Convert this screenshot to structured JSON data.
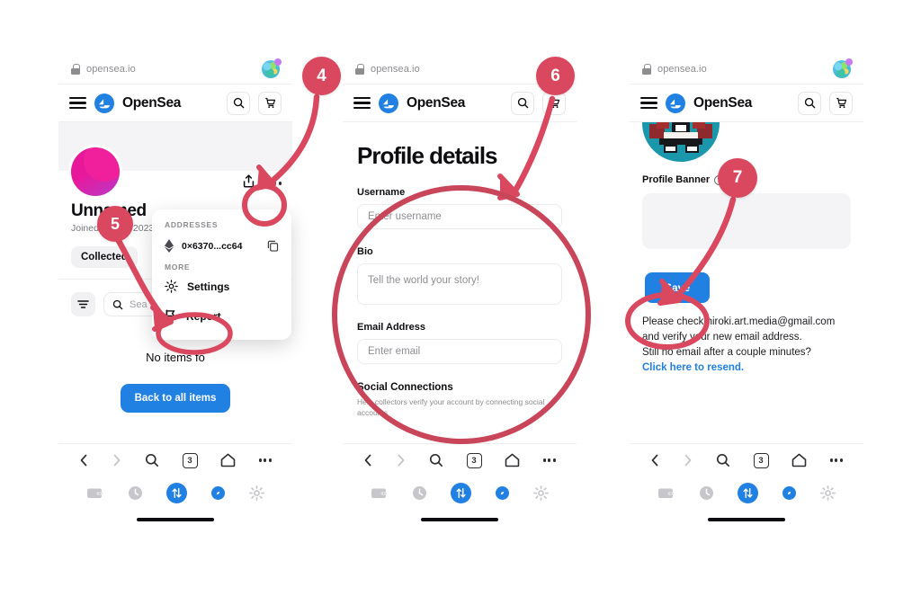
{
  "meta": {
    "accent_blue": "#2081e2",
    "annotation_red": "#d9485f",
    "avatar_pink": "#e8189a"
  },
  "panels": [
    {
      "id": "panel-1-profile-menu",
      "browser": {
        "url": "opensea.io",
        "favicon": "globe-icon"
      },
      "header": {
        "brand": "OpenSea",
        "menu_icon": "hamburger-icon",
        "search_icon": "search-icon",
        "cart_icon": "cart-icon"
      },
      "profile": {
        "name": "Unnamed",
        "joined": "Joined August 2023",
        "share_icon": "share-icon",
        "more_icon": "more-horizontal-icon",
        "tabs": [
          {
            "label": "Collected",
            "active": true
          },
          {
            "label": "O",
            "active": false
          }
        ],
        "filter_icon": "filter-icon",
        "search_placeholder": "Sea",
        "empty_message": "No items fo",
        "primary_button": "Back to all items"
      },
      "dropdown": {
        "addresses_label": "ADDRESSES",
        "address": "0×6370...cc64",
        "wallet_icon": "ethereum-icon",
        "copy_icon": "copy-icon",
        "more_label": "MORE",
        "items": [
          {
            "label": "Settings",
            "icon": "gear-icon"
          },
          {
            "label": "Report",
            "icon": "flag-icon"
          }
        ]
      },
      "bottom_nav": {
        "back_icon": "chevron-left-icon",
        "forward_icon": "chevron-right-icon",
        "search_icon": "search-icon",
        "tab_count": "3",
        "home_icon": "home-icon",
        "more_icon": "more-horizontal-icon"
      },
      "tool_nav": {
        "wallet_icon": "wallet-icon",
        "history_icon": "clock-icon",
        "swap_icon": "swap-arrows-icon",
        "browser_icon": "compass-icon",
        "settings_icon": "gear-icon"
      }
    },
    {
      "id": "panel-2-profile-details",
      "browser": {
        "url": "opensea.io",
        "favicon": "globe-icon"
      },
      "header": {
        "brand": "OpenSea",
        "menu_icon": "hamburger-icon",
        "search_icon": "search-icon",
        "cart_icon": "cart-icon"
      },
      "form": {
        "title": "Profile details",
        "username_label": "Username",
        "username_placeholder": "Enter username",
        "bio_label": "Bio",
        "bio_placeholder": "Tell the world your story!",
        "email_label": "Email Address",
        "email_placeholder": "Enter email",
        "social_title": "Social Connections",
        "social_help": "Help collectors verify your account by connecting social accounts"
      },
      "bottom_nav": {
        "back_icon": "chevron-left-icon",
        "forward_icon": "chevron-right-icon",
        "search_icon": "search-icon",
        "tab_count": "3",
        "home_icon": "home-icon",
        "more_icon": "more-horizontal-icon"
      }
    },
    {
      "id": "panel-3-save-verify",
      "browser": {
        "url": "opensea.io",
        "favicon": "globe-icon"
      },
      "header": {
        "brand": "OpenSea",
        "menu_icon": "hamburger-icon",
        "search_icon": "search-icon",
        "cart_icon": "cart-icon"
      },
      "content": {
        "avatar_alt": "pixel-art-avatar",
        "banner_label": "Profile Banner",
        "banner_info_icon": "info-icon",
        "save_button": "Save",
        "verify_line_1": "Please check hiroki.art.media@gmail.com",
        "verify_line_2": "and verify your new email address.",
        "verify_line_3": "Still no email after a couple minutes?",
        "verify_link": "Click here to resend."
      },
      "bottom_nav": {
        "back_icon": "chevron-left-icon",
        "forward_icon": "chevron-right-icon",
        "search_icon": "search-icon",
        "tab_count": "3",
        "home_icon": "home-icon",
        "more_icon": "more-horizontal-icon"
      }
    }
  ],
  "annotations": {
    "step_4": "4",
    "step_5": "5",
    "step_6": "6",
    "step_7": "7"
  }
}
